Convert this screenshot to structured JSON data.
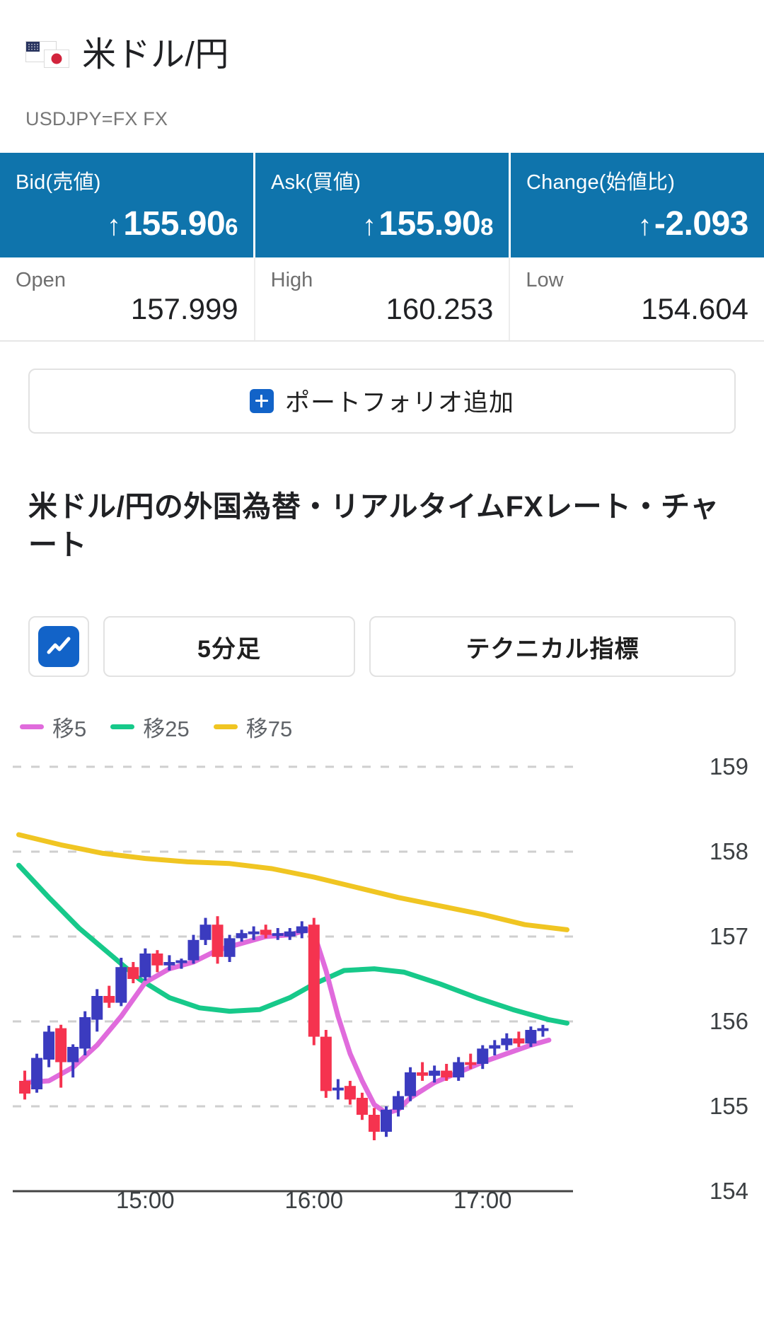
{
  "header": {
    "title": "米ドル/円",
    "symbol_line": "USDJPY=FX FX",
    "flag_left": "us-flag-icon",
    "flag_right": "jp-flag-icon"
  },
  "quote": {
    "cells": [
      {
        "label": "Bid(売値)",
        "arrow": "↑",
        "main": "155.90",
        "sub": "6"
      },
      {
        "label": "Ask(買値)",
        "arrow": "↑",
        "main": "155.90",
        "sub": "8"
      },
      {
        "label": "Change(始値比)",
        "arrow": "↑",
        "main": "-2.093",
        "sub": ""
      }
    ],
    "ohl": [
      {
        "label": "Open",
        "value": "157.999"
      },
      {
        "label": "High",
        "value": "160.253"
      },
      {
        "label": "Low",
        "value": "154.604"
      }
    ],
    "accent_color": "#0f74ac"
  },
  "portfolio": {
    "label": "ポートフォリオ追加",
    "icon": "plus-square-icon"
  },
  "section": {
    "heading": "米ドル/円の外国為替・リアルタイムFXレート・チャート"
  },
  "controls": {
    "chart_type_icon": "line-chart-icon",
    "interval_label": "5分足",
    "technical_label": "テクニカル指標"
  },
  "chart_data": {
    "type": "line",
    "subtype": "candlestick-with-moving-averages",
    "title": "",
    "xlabel": "",
    "ylabel": "",
    "ylim": [
      154,
      159
    ],
    "y_ticks": [
      159,
      158,
      157,
      156,
      155,
      154
    ],
    "x_ticks": [
      {
        "label": "15:00",
        "x": 44
      },
      {
        "label": "16:00",
        "x": 100
      },
      {
        "label": "17:00",
        "x": 156
      }
    ],
    "x_range": [
      0,
      186
    ],
    "grid": true,
    "legend_position": "top-left",
    "legend": [
      {
        "name": "移5",
        "color": "#e06bdc"
      },
      {
        "name": "移25",
        "color": "#17c98a"
      },
      {
        "name": "移75",
        "color": "#f0c522"
      }
    ],
    "candle_colors": {
      "up": "#3b3bbf",
      "down": "#f5334f"
    },
    "candles": [
      {
        "t": 4,
        "o": 155.3,
        "h": 155.42,
        "l": 155.08,
        "c": 155.15
      },
      {
        "t": 8,
        "o": 155.2,
        "h": 155.62,
        "l": 155.16,
        "c": 155.57
      },
      {
        "t": 12,
        "o": 155.55,
        "h": 155.95,
        "l": 155.46,
        "c": 155.88
      },
      {
        "t": 16,
        "o": 155.92,
        "h": 155.96,
        "l": 155.22,
        "c": 155.52
      },
      {
        "t": 20,
        "o": 155.52,
        "h": 155.73,
        "l": 155.34,
        "c": 155.7
      },
      {
        "t": 24,
        "o": 155.68,
        "h": 156.12,
        "l": 155.6,
        "c": 156.05
      },
      {
        "t": 28,
        "o": 156.02,
        "h": 156.38,
        "l": 155.88,
        "c": 156.3
      },
      {
        "t": 32,
        "o": 156.3,
        "h": 156.42,
        "l": 156.16,
        "c": 156.22
      },
      {
        "t": 36,
        "o": 156.22,
        "h": 156.75,
        "l": 156.18,
        "c": 156.64
      },
      {
        "t": 40,
        "o": 156.64,
        "h": 156.7,
        "l": 156.45,
        "c": 156.5
      },
      {
        "t": 44,
        "o": 156.52,
        "h": 156.86,
        "l": 156.48,
        "c": 156.8
      },
      {
        "t": 48,
        "o": 156.8,
        "h": 156.84,
        "l": 156.58,
        "c": 156.66
      },
      {
        "t": 52,
        "o": 156.66,
        "h": 156.78,
        "l": 156.6,
        "c": 156.7
      },
      {
        "t": 56,
        "o": 156.7,
        "h": 156.74,
        "l": 156.62,
        "c": 156.72
      },
      {
        "t": 60,
        "o": 156.72,
        "h": 157.02,
        "l": 156.68,
        "c": 156.96
      },
      {
        "t": 64,
        "o": 156.96,
        "h": 157.22,
        "l": 156.9,
        "c": 157.14
      },
      {
        "t": 68,
        "o": 157.14,
        "h": 157.24,
        "l": 156.68,
        "c": 156.76
      },
      {
        "t": 72,
        "o": 156.76,
        "h": 157.02,
        "l": 156.7,
        "c": 156.98
      },
      {
        "t": 76,
        "o": 156.98,
        "h": 157.08,
        "l": 156.94,
        "c": 157.04
      },
      {
        "t": 80,
        "o": 157.04,
        "h": 157.12,
        "l": 156.96,
        "c": 157.06
      },
      {
        "t": 84,
        "o": 157.08,
        "h": 157.14,
        "l": 156.98,
        "c": 157.02
      },
      {
        "t": 88,
        "o": 157.02,
        "h": 157.1,
        "l": 156.96,
        "c": 157.04
      },
      {
        "t": 92,
        "o": 157.0,
        "h": 157.1,
        "l": 156.96,
        "c": 157.06
      },
      {
        "t": 96,
        "o": 157.04,
        "h": 157.18,
        "l": 156.98,
        "c": 157.12
      },
      {
        "t": 100,
        "o": 157.14,
        "h": 157.22,
        "l": 155.72,
        "c": 155.82
      },
      {
        "t": 104,
        "o": 155.82,
        "h": 155.9,
        "l": 155.1,
        "c": 155.18
      },
      {
        "t": 108,
        "o": 155.2,
        "h": 155.32,
        "l": 155.08,
        "c": 155.22
      },
      {
        "t": 112,
        "o": 155.24,
        "h": 155.3,
        "l": 155.02,
        "c": 155.08
      },
      {
        "t": 116,
        "o": 155.1,
        "h": 155.16,
        "l": 154.84,
        "c": 154.9
      },
      {
        "t": 120,
        "o": 154.9,
        "h": 154.98,
        "l": 154.6,
        "c": 154.7
      },
      {
        "t": 124,
        "o": 154.7,
        "h": 155.0,
        "l": 154.64,
        "c": 154.96
      },
      {
        "t": 128,
        "o": 154.96,
        "h": 155.18,
        "l": 154.88,
        "c": 155.12
      },
      {
        "t": 132,
        "o": 155.12,
        "h": 155.46,
        "l": 155.06,
        "c": 155.4
      },
      {
        "t": 136,
        "o": 155.4,
        "h": 155.52,
        "l": 155.3,
        "c": 155.36
      },
      {
        "t": 140,
        "o": 155.36,
        "h": 155.48,
        "l": 155.28,
        "c": 155.42
      },
      {
        "t": 144,
        "o": 155.42,
        "h": 155.5,
        "l": 155.3,
        "c": 155.34
      },
      {
        "t": 148,
        "o": 155.34,
        "h": 155.58,
        "l": 155.3,
        "c": 155.52
      },
      {
        "t": 152,
        "o": 155.52,
        "h": 155.62,
        "l": 155.44,
        "c": 155.5
      },
      {
        "t": 156,
        "o": 155.5,
        "h": 155.72,
        "l": 155.44,
        "c": 155.68
      },
      {
        "t": 160,
        "o": 155.68,
        "h": 155.78,
        "l": 155.6,
        "c": 155.72
      },
      {
        "t": 164,
        "o": 155.72,
        "h": 155.86,
        "l": 155.66,
        "c": 155.8
      },
      {
        "t": 168,
        "o": 155.8,
        "h": 155.88,
        "l": 155.7,
        "c": 155.74
      },
      {
        "t": 172,
        "o": 155.74,
        "h": 155.94,
        "l": 155.7,
        "c": 155.9
      },
      {
        "t": 176,
        "o": 155.9,
        "h": 155.96,
        "l": 155.82,
        "c": 155.92
      }
    ],
    "series": [
      {
        "name": "移75",
        "color": "#f0c522",
        "points": [
          [
            2,
            158.2
          ],
          [
            16,
            158.08
          ],
          [
            30,
            157.98
          ],
          [
            44,
            157.92
          ],
          [
            58,
            157.88
          ],
          [
            72,
            157.86
          ],
          [
            86,
            157.8
          ],
          [
            100,
            157.7
          ],
          [
            114,
            157.58
          ],
          [
            128,
            157.46
          ],
          [
            142,
            157.36
          ],
          [
            156,
            157.26
          ],
          [
            170,
            157.14
          ],
          [
            184,
            157.08
          ]
        ]
      },
      {
        "name": "移25",
        "color": "#17c98a",
        "points": [
          [
            2,
            157.84
          ],
          [
            12,
            157.46
          ],
          [
            22,
            157.1
          ],
          [
            32,
            156.8
          ],
          [
            42,
            156.5
          ],
          [
            52,
            156.28
          ],
          [
            62,
            156.16
          ],
          [
            72,
            156.12
          ],
          [
            82,
            156.14
          ],
          [
            92,
            156.28
          ],
          [
            100,
            156.44
          ],
          [
            110,
            156.6
          ],
          [
            120,
            156.62
          ],
          [
            130,
            156.58
          ],
          [
            142,
            156.44
          ],
          [
            154,
            156.28
          ],
          [
            166,
            156.14
          ],
          [
            178,
            156.02
          ],
          [
            184,
            155.98
          ]
        ]
      },
      {
        "name": "移5",
        "color": "#e06bdc",
        "points": [
          [
            4,
            155.28
          ],
          [
            12,
            155.3
          ],
          [
            20,
            155.46
          ],
          [
            28,
            155.72
          ],
          [
            36,
            156.06
          ],
          [
            44,
            156.46
          ],
          [
            52,
            156.62
          ],
          [
            60,
            156.7
          ],
          [
            68,
            156.84
          ],
          [
            76,
            156.92
          ],
          [
            84,
            157.0
          ],
          [
            92,
            157.02
          ],
          [
            98,
            157.08
          ],
          [
            100,
            157.04
          ],
          [
            104,
            156.6
          ],
          [
            108,
            156.06
          ],
          [
            112,
            155.62
          ],
          [
            116,
            155.3
          ],
          [
            120,
            155.02
          ],
          [
            124,
            154.92
          ],
          [
            128,
            154.96
          ],
          [
            132,
            155.1
          ],
          [
            140,
            155.28
          ],
          [
            148,
            155.4
          ],
          [
            156,
            155.52
          ],
          [
            164,
            155.62
          ],
          [
            172,
            155.72
          ],
          [
            178,
            155.78
          ]
        ]
      }
    ]
  }
}
